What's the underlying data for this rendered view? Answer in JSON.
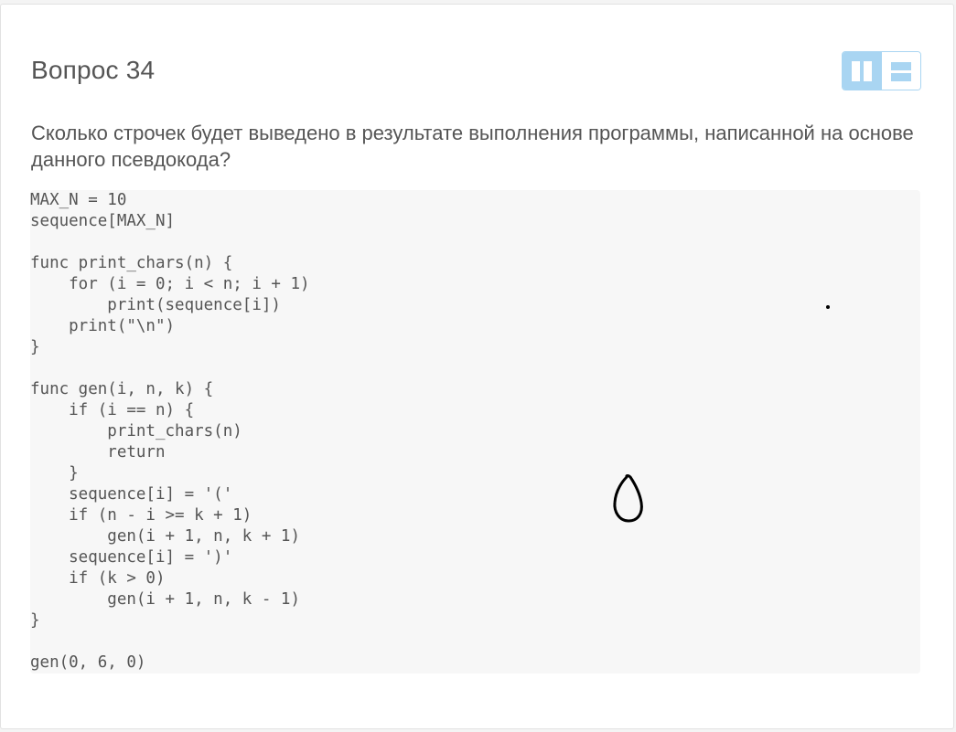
{
  "question": {
    "title": "Вопрос 34",
    "text": "Сколько строчек будет выведено в результате выполнения программы, написанной на основе данного псевдокода?"
  },
  "layout_toggle": {
    "options": [
      {
        "icon": "two-columns-icon",
        "active": true
      },
      {
        "icon": "two-rows-icon",
        "active": false
      }
    ],
    "accent_color": "#a9d5f2"
  },
  "code_lines": [
    "MAX_N = 10",
    "sequence[MAX_N]",
    "",
    "func print_chars(n) {",
    "    for (i = 0; i < n; i + 1)",
    "        print(sequence[i])",
    "    print(\"\\n\")",
    "}",
    "",
    "func gen(i, n, k) {",
    "    if (i == n) {",
    "        print_chars(n)",
    "        return",
    "    }",
    "    sequence[i] = '('",
    "    if (n - i >= k + 1)",
    "        gen(i + 1, n, k + 1)",
    "    sequence[i] = ')'",
    "    if (k > 0)",
    "        gen(i + 1, n, k - 1)",
    "}",
    "",
    "gen(0, 6, 0)"
  ],
  "colors": {
    "text": "#555555",
    "code_background": "#f7f7f7"
  }
}
